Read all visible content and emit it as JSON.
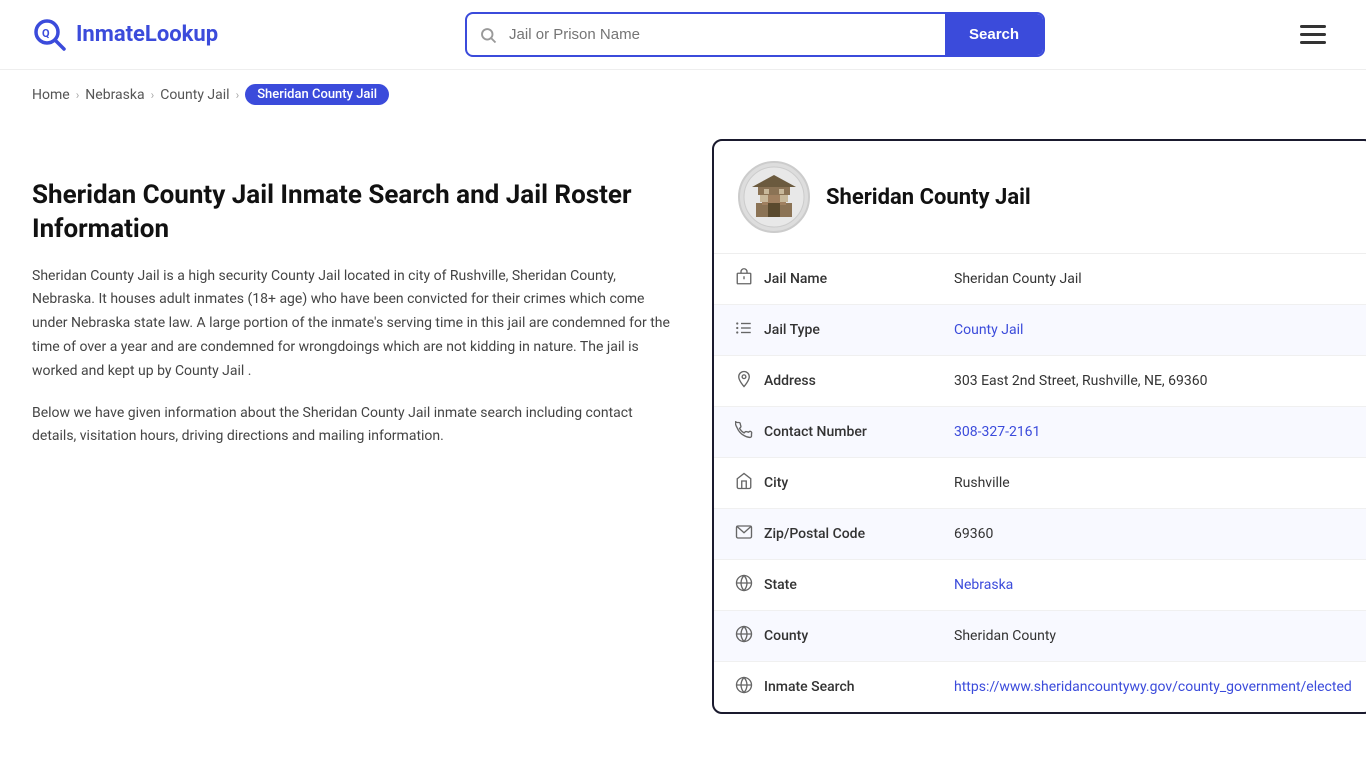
{
  "header": {
    "logo_text": "InmateLookup",
    "search_placeholder": "Jail or Prison Name",
    "search_button_label": "Search"
  },
  "breadcrumb": {
    "home": "Home",
    "nebraska": "Nebraska",
    "county_jail": "County Jail",
    "active": "Sheridan County Jail"
  },
  "left": {
    "page_title": "Sheridan County Jail Inmate Search and Jail Roster Information",
    "desc1": "Sheridan County Jail is a high security County Jail located in city of Rushville, Sheridan County, Nebraska. It houses adult inmates (18+ age) who have been convicted for their crimes which come under Nebraska state law. A large portion of the inmate's serving time in this jail are condemned for the time of over a year and are condemned for wrongdoings which are not kidding in nature. The jail is worked and kept up by County Jail .",
    "desc2": "Below we have given information about the Sheridan County Jail inmate search including contact details, visitation hours, driving directions and mailing information."
  },
  "card": {
    "name": "Sheridan County Jail",
    "rows": [
      {
        "icon": "building-icon",
        "label": "Jail Name",
        "value": "Sheridan County Jail",
        "type": "text"
      },
      {
        "icon": "list-icon",
        "label": "Jail Type",
        "value": "County Jail",
        "type": "link"
      },
      {
        "icon": "pin-icon",
        "label": "Address",
        "value": "303 East 2nd Street, Rushville, NE, 69360",
        "type": "text"
      },
      {
        "icon": "phone-icon",
        "label": "Contact Number",
        "value": "308-327-2161",
        "type": "link"
      },
      {
        "icon": "city-icon",
        "label": "City",
        "value": "Rushville",
        "type": "text"
      },
      {
        "icon": "mail-icon",
        "label": "Zip/Postal Code",
        "value": "69360",
        "type": "text"
      },
      {
        "icon": "globe-icon",
        "label": "State",
        "value": "Nebraska",
        "type": "link"
      },
      {
        "icon": "county-icon",
        "label": "County",
        "value": "Sheridan County",
        "type": "text"
      },
      {
        "icon": "search-globe-icon",
        "label": "Inmate Search",
        "value": "https://www.sheridancountywy.gov/county_government/elected",
        "type": "link"
      }
    ]
  }
}
